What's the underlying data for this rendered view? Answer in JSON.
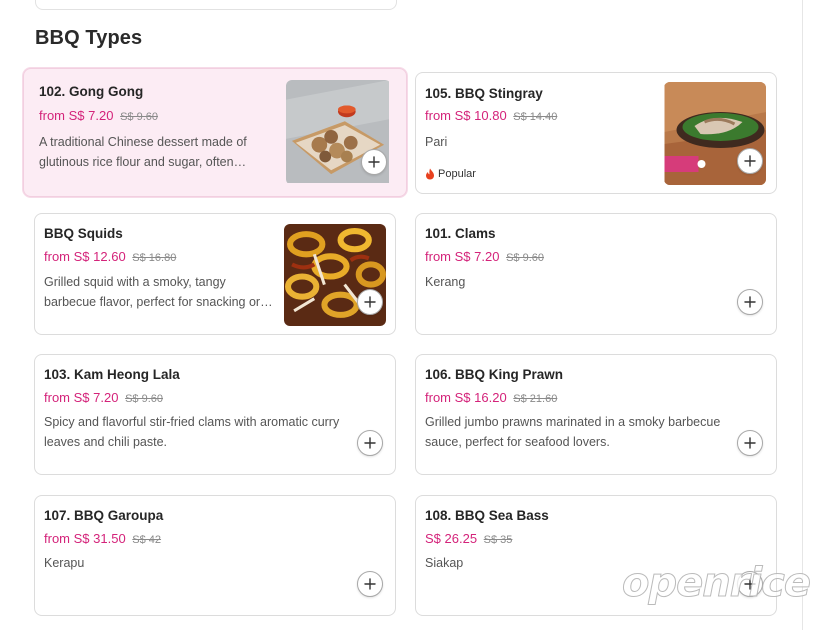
{
  "section": {
    "title": "BBQ Types"
  },
  "items": [
    {
      "name": "102. Gong Gong",
      "price_prefix": "from",
      "price": "S$ 7.20",
      "old_price": "S$ 9.60",
      "description": "A traditional Chinese dessert made of glutinous rice flour and sugar, often served in a sweet syrup.",
      "image": "gong-gong-photo"
    },
    {
      "name": "105. BBQ Stingray",
      "price_prefix": "from",
      "price": "S$ 10.80",
      "old_price": "S$ 14.40",
      "description": "Pari",
      "tag": "Popular",
      "image": "bbq-stingray-photo"
    },
    {
      "name": "BBQ Squids",
      "price_prefix": "from",
      "price": "S$ 12.60",
      "old_price": "S$ 16.80",
      "description": "Grilled squid with a smoky, tangy barbecue flavor, perfect for snacking or sharing.",
      "image": "bbq-squids-photo"
    },
    {
      "name": "101. Clams",
      "price_prefix": "from",
      "price": "S$ 7.20",
      "old_price": "S$ 9.60",
      "description": "Kerang"
    },
    {
      "name": "103. Kam Heong Lala",
      "price_prefix": "from",
      "price": "S$ 7.20",
      "old_price": "S$ 9.60",
      "description": "Spicy and flavorful stir-fried clams with aromatic curry leaves and chili paste."
    },
    {
      "name": "106. BBQ King Prawn",
      "price_prefix": "from",
      "price": "S$ 16.20",
      "old_price": "S$ 21.60",
      "description": "Grilled jumbo prawns marinated in a smoky barbecue sauce, perfect for seafood lovers."
    },
    {
      "name": "107. BBQ Garoupa",
      "price_prefix": "from",
      "price": "S$ 31.50",
      "old_price": "S$ 42",
      "description": "Kerapu"
    },
    {
      "name": "108. BBQ Sea Bass",
      "price_prefix": "",
      "price": "S$ 26.25",
      "old_price": "S$ 35",
      "description": "Siakap"
    }
  ],
  "watermark": "openrice",
  "colors": {
    "price": "#d4237a",
    "highlight_bg": "#fcecf4",
    "tag_icon": "#e8411f"
  },
  "icons": {
    "add": "plus-icon",
    "tag": "flame-icon"
  }
}
